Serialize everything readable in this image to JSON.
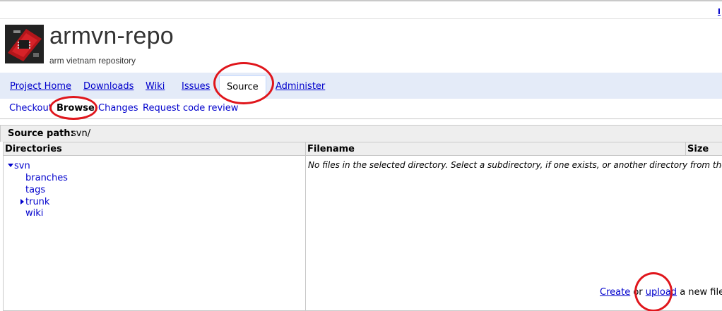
{
  "header": {
    "project_name": "armvn-repo",
    "project_summary": "arm vietnam repository",
    "top_link": "I"
  },
  "tabs": [
    {
      "label": "Project Home",
      "active": false
    },
    {
      "label": "Downloads",
      "active": false
    },
    {
      "label": "Wiki",
      "active": false
    },
    {
      "label": "Issues",
      "active": false
    },
    {
      "label": "Source",
      "active": true
    },
    {
      "label": "Administer",
      "active": false
    }
  ],
  "subnav": [
    {
      "label": "Checkout",
      "active": false
    },
    {
      "label": "Browse",
      "active": true
    },
    {
      "label": "Changes",
      "active": false
    },
    {
      "label": "Request code review",
      "active": false
    }
  ],
  "source_path": {
    "label": "Source path:",
    "value": "svn/"
  },
  "directories": {
    "header": "Directories",
    "root": "svn",
    "children": [
      "branches",
      "tags",
      "trunk",
      "wiki"
    ]
  },
  "files": {
    "filename_header": "Filename",
    "size_header": "Size",
    "empty_message": "No files in the selected directory. Select a subdirectory, if one exists, or another directory from the tree",
    "create_label": "Create",
    "or_text": " or ",
    "upload_label": "upload",
    "new_file_text": " a new file"
  },
  "colors": {
    "link": "#0000cc",
    "tab_bar_bg": "#e4ebf8",
    "header_bg": "#eeeeee",
    "annotation_circle": "#e0161c"
  }
}
